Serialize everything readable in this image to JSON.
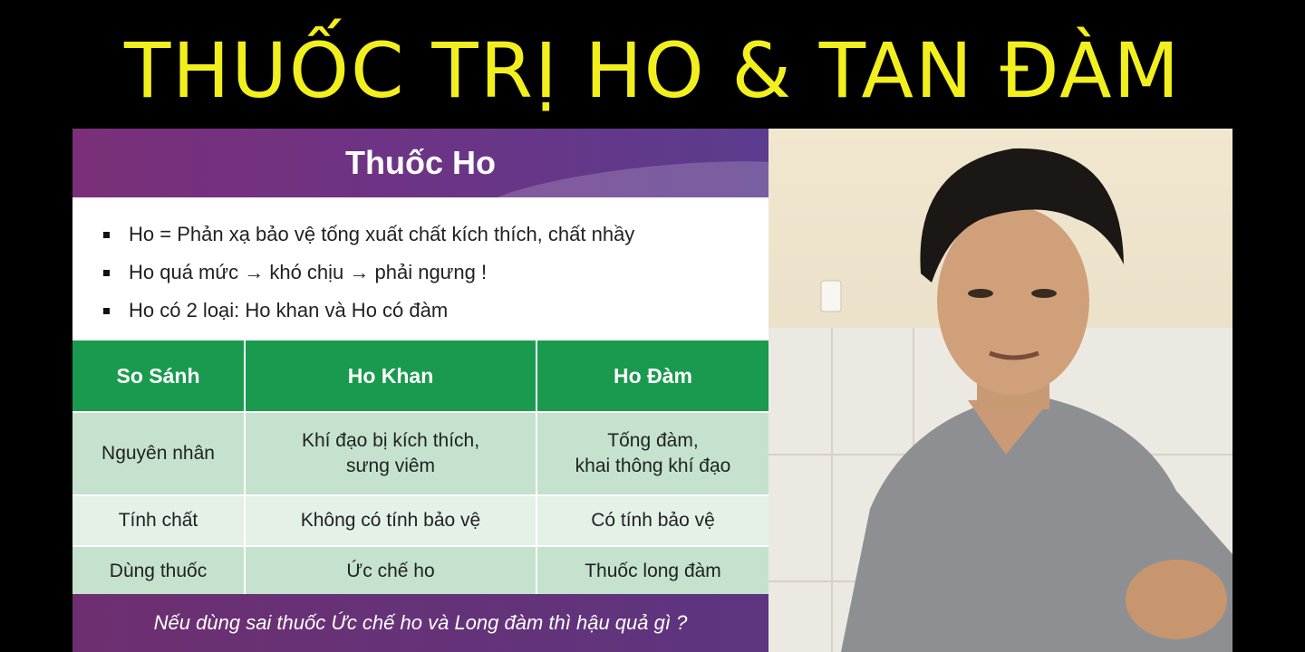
{
  "video_title": "THUỐC TRỊ HO & TAN ĐÀM",
  "slide": {
    "title": "Thuốc Ho",
    "bullets": [
      "Ho = Phản xạ bảo vệ tống xuất chất kích thích, chất nhầy",
      "Ho quá mức → khó chịu → phải ngưng !",
      "Ho có 2 loại: Ho khan và Ho có đàm"
    ],
    "table": {
      "headers": [
        "So Sánh",
        "Ho Khan",
        "Ho Đàm"
      ],
      "rows": [
        {
          "label": "Nguyên nhân",
          "ho_khan_1": "Khí đạo bị kích thích,",
          "ho_khan_2": "sưng viêm",
          "ho_dam_1": "Tống đàm,",
          "ho_dam_2": "khai thông khí đạo"
        },
        {
          "label": "Tính chất",
          "ho_khan": "Không có tính bảo vệ",
          "ho_dam": "Có tính bảo vệ"
        },
        {
          "label": "Dùng thuốc",
          "ho_khan": "Ức chế ho",
          "ho_dam": "Thuốc long đàm"
        }
      ]
    },
    "footer": "Nếu dùng sai thuốc Ức chế ho và Long đàm thì hậu quả gì ?",
    "colors": {
      "title_yellow": "#f2ef1e",
      "header_purple": "#6e3384",
      "table_green": "#1a9a4e"
    }
  }
}
